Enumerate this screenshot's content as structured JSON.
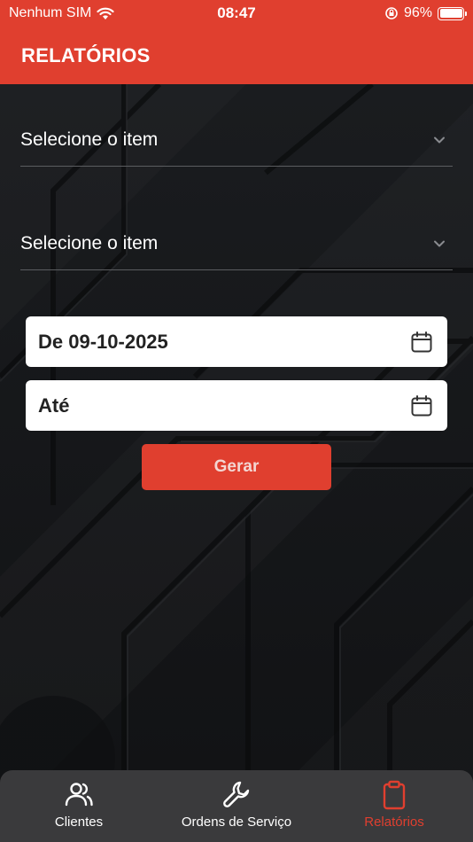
{
  "status_bar": {
    "carrier": "Nenhum SIM",
    "time": "08:47",
    "battery": "96%"
  },
  "header": {
    "title": "RELATÓRIOS"
  },
  "form": {
    "select_1": {
      "placeholder": "Selecione o item"
    },
    "select_2": {
      "placeholder": "Selecione o item"
    },
    "date_from": {
      "label": "De 09-10-2025"
    },
    "date_to": {
      "label": "Até"
    },
    "generate_label": "Gerar"
  },
  "tabbar": {
    "tabs": [
      {
        "label": "Clientes",
        "icon": "users-icon",
        "active": false
      },
      {
        "label": "Ordens de Serviço",
        "icon": "wrench-icon",
        "active": false
      },
      {
        "label": "Relatórios",
        "icon": "clipboard-icon",
        "active": true
      }
    ]
  },
  "colors": {
    "accent": "#e03f2f",
    "background": "#121315",
    "tabbar": "#3a3a3c"
  }
}
